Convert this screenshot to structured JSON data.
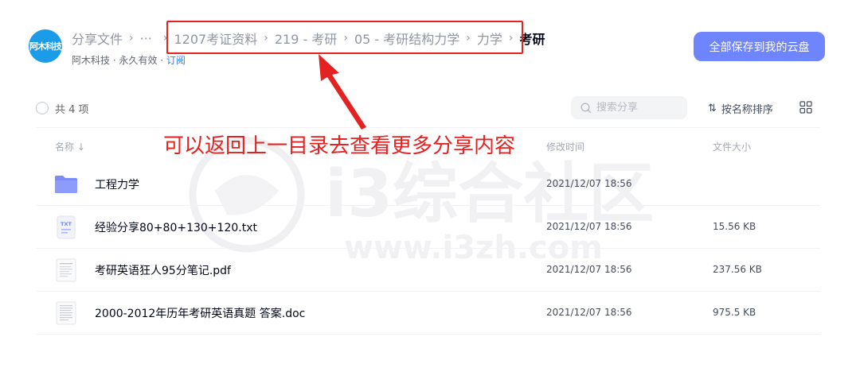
{
  "share": {
    "avatar_text": "阿木科技",
    "breadcrumb": {
      "root": "分享文件",
      "ellipsis": "···",
      "items": [
        "1207考证资料",
        "219 - 考研",
        "05 - 考研结构力学",
        "力学"
      ],
      "current": "考研"
    },
    "owner": "阿木科技 · 永久有效 · ",
    "subscribe_link": "订阅",
    "save_all_button": "全部保存到我的云盘"
  },
  "toolbar": {
    "count": "共 4 项",
    "search_placeholder": "搜索分享",
    "sort_label": "按名称排序",
    "sort_icon": "sort-arrows-icon",
    "view_icon": "grid-view-icon"
  },
  "table": {
    "columns": {
      "name": "名称 ↓",
      "modified": "修改时间",
      "size": "文件大小"
    },
    "rows": [
      {
        "icon": "folder-icon",
        "name": "工程力学",
        "time": "2021/12/07 18:56",
        "size": ""
      },
      {
        "icon": "txt-file-icon",
        "name": "经验分享80+80+130+120.txt",
        "time": "2021/12/07 18:56",
        "size": "15.56 KB"
      },
      {
        "icon": "pdf-file-icon",
        "name": "考研英语狂人95分笔记.pdf",
        "time": "2021/12/07 18:56",
        "size": "237.56 KB"
      },
      {
        "icon": "doc-file-icon",
        "name": "2000-2012年历年考研英语真题 答案.doc",
        "time": "2021/12/07 18:56",
        "size": "975.5 KB"
      }
    ]
  },
  "annotation": {
    "text": "可以返回上一目录去查看更多分享内容",
    "color": "#e52222"
  },
  "watermark": {
    "logo_text": "i3综合社区",
    "url": "www.i3zh.com"
  },
  "colors": {
    "accent": "#6f85fd",
    "link": "#2e7cf6",
    "folder": "#7b8cf8"
  }
}
